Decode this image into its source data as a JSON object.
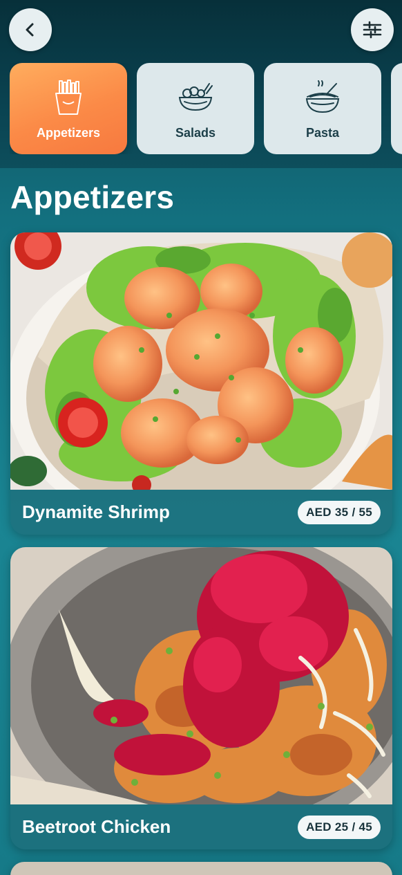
{
  "header": {
    "back_icon": "chevron-left-icon",
    "filter_icon": "sliders-icon"
  },
  "categories": [
    {
      "label": "Appetizers",
      "icon": "fries-icon",
      "active": true
    },
    {
      "label": "Salads",
      "icon": "salad-bowl-icon",
      "active": false
    },
    {
      "label": "Pasta",
      "icon": "noodle-bowl-icon",
      "active": false
    }
  ],
  "section": {
    "title": "Appetizers"
  },
  "items": [
    {
      "name": "Dynamite Shrimp",
      "price": "AED 35 / 55",
      "image": "dynamite-shrimp-photo"
    },
    {
      "name": "Beetroot Chicken",
      "price": "AED 25 / 45",
      "image": "beetroot-chicken-photo"
    }
  ],
  "colors": {
    "accent": "#fb8a47",
    "header_bg": "#0a4250",
    "page_bg": "#167a88"
  }
}
